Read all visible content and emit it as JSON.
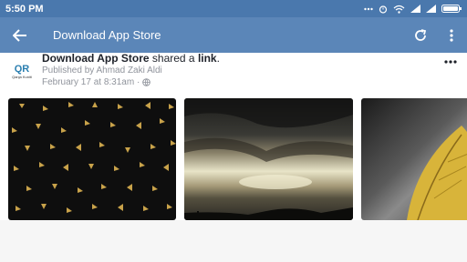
{
  "status_bar": {
    "time": "5:50 PM"
  },
  "app_bar": {
    "title": "Download App Store"
  },
  "post": {
    "page_name": "Download App Store",
    "action_text": " shared a ",
    "object_text": "link",
    "end_text": ".",
    "published_by": "Published by Ahmad Zaki Aldi",
    "timestamp": "February 17 at 8:31am ·",
    "avatar_logo": "QR",
    "avatar_text": "Qanja Kuniti"
  },
  "colors": {
    "status_bar": "#4a78ad",
    "app_bar": "#5b86b8",
    "accent_gold": "#c8a24a"
  }
}
